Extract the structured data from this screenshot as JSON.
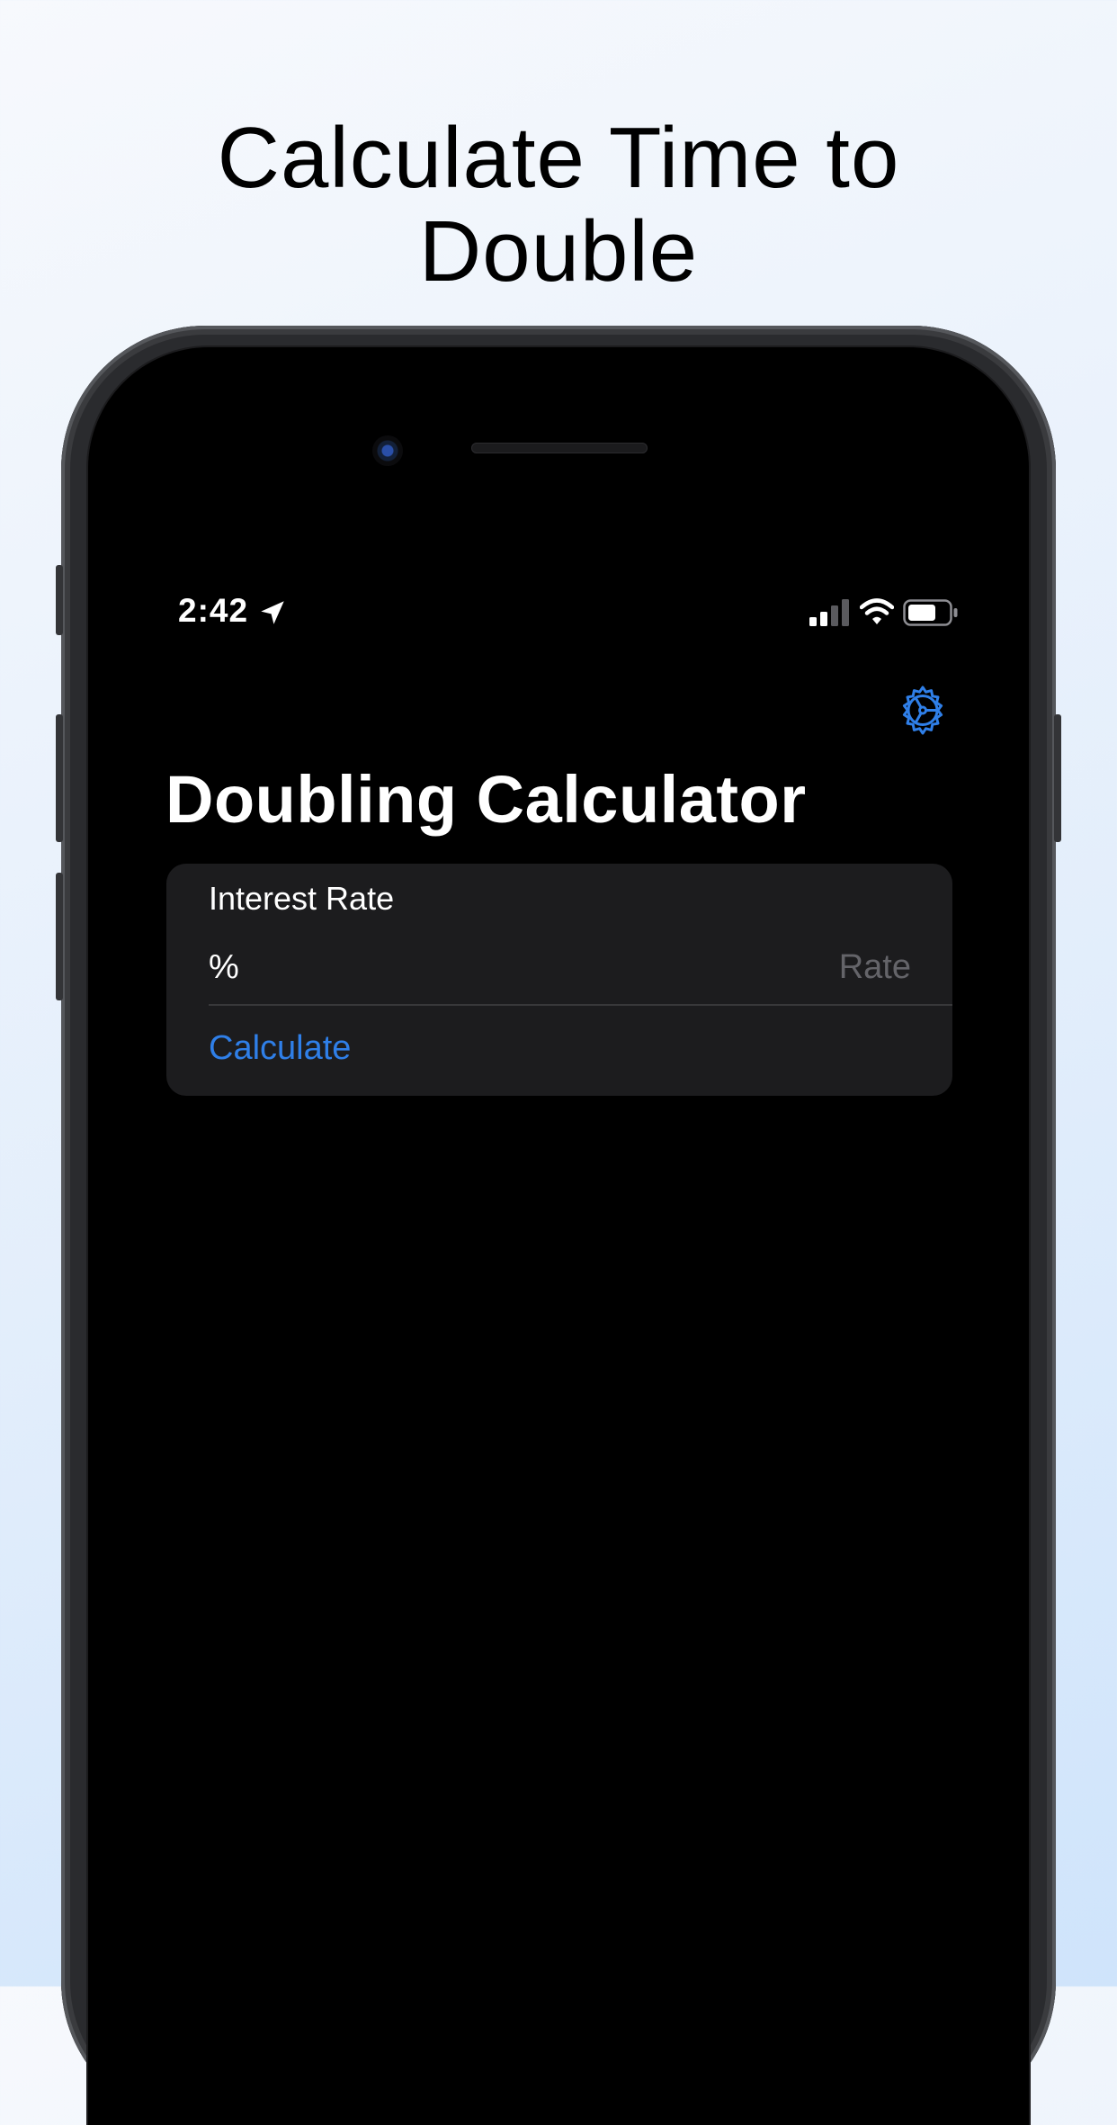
{
  "headline": "Calculate Time to Double",
  "status_bar": {
    "time": "2:42",
    "icons": [
      "location-arrow-icon",
      "cellular-signal-icon",
      "wifi-icon",
      "battery-icon"
    ]
  },
  "nav": {
    "settings_icon": "gear-icon"
  },
  "title": "Doubling Calculator",
  "form": {
    "section_label": "Interest Rate",
    "rate_unit": "%",
    "rate_placeholder": "Rate",
    "rate_value": "",
    "calculate_label": "Calculate"
  },
  "colors": {
    "accent": "#2f7fe8",
    "screen_background": "#000000",
    "card_background": "#1c1c1e",
    "placeholder": "#646469"
  }
}
